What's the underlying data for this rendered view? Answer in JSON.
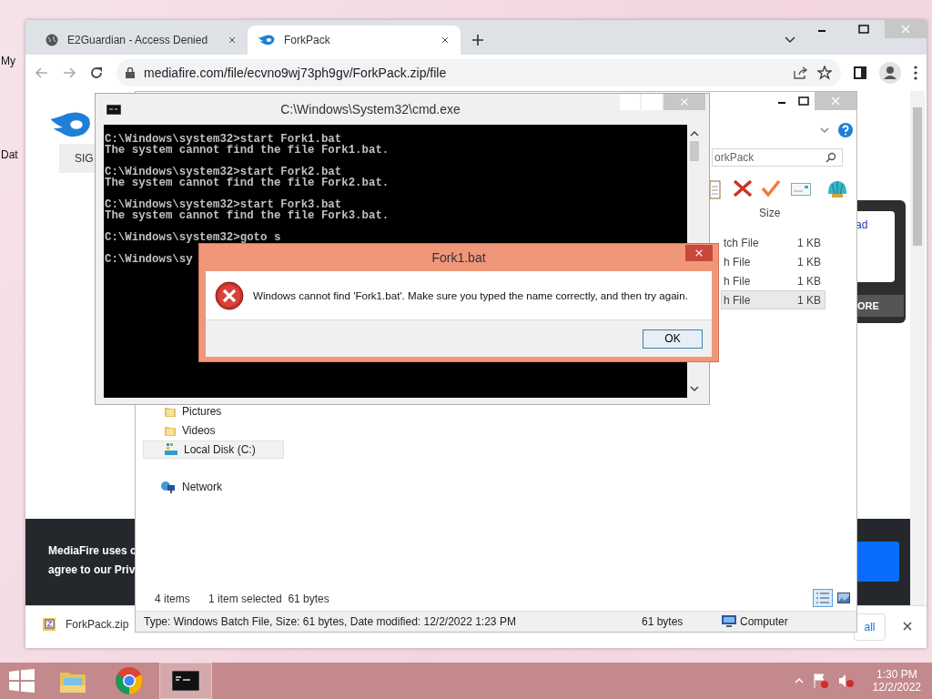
{
  "desktop": {
    "icon_labels": [
      "My",
      "Dat"
    ]
  },
  "browser": {
    "tabs": [
      {
        "title": "E2Guardian - Access Denied",
        "kind": "globe",
        "selected": false
      },
      {
        "title": "ForkPack",
        "kind": "mediafire",
        "selected": true
      }
    ],
    "address": "mediafire.com/file/ecvno9wj73ph9gv/ForkPack.zip/file",
    "page": {
      "sign_in_button": "SIG",
      "side_link": "ad",
      "side_button": "ORE",
      "cookie_lines": [
        "MediaFire uses c",
        "agree to our Priv"
      ]
    },
    "download_bar": {
      "file": "ForkPack.zip",
      "show_all": "all"
    }
  },
  "explorer": {
    "search": "orkPack",
    "columns": [
      "Size"
    ],
    "files": [
      {
        "type": "tch File",
        "size": "1 KB",
        "selected": false
      },
      {
        "type": "h File",
        "size": "1 KB",
        "selected": false
      },
      {
        "type": "h File",
        "size": "1 KB",
        "selected": false
      },
      {
        "type": "h File",
        "size": "1 KB",
        "selected": true
      }
    ],
    "nav": [
      {
        "label": "Pictures",
        "kind": "folder",
        "selected": false
      },
      {
        "label": "Videos",
        "kind": "folder",
        "selected": false
      },
      {
        "label": "Local Disk (C:)",
        "kind": "drive",
        "selected": true
      },
      {
        "label": "Network",
        "kind": "network",
        "selected": false
      }
    ],
    "item_count": "4 items",
    "selection": "1 item selected  61 bytes",
    "details": "Type: Windows Batch File, Size: 61 bytes, Date modified: 12/2/2022 1:23 PM",
    "details_size": "61 bytes",
    "details_location": "Computer"
  },
  "console": {
    "title": "C:\\Windows\\System32\\cmd.exe",
    "blocks": [
      [
        "C:\\Windows\\system32>start Fork1.bat",
        "The system cannot find the file Fork1.bat."
      ],
      [
        "C:\\Windows\\system32>start Fork2.bat",
        "The system cannot find the file Fork2.bat."
      ],
      [
        "C:\\Windows\\system32>start Fork3.bat",
        "The system cannot find the file Fork3.bat."
      ],
      [
        "C:\\Windows\\system32>goto s"
      ],
      [
        "C:\\Windows\\sy"
      ]
    ]
  },
  "dialog": {
    "title": "Fork1.bat",
    "message": "Windows cannot find 'Fork1.bat'. Make sure you typed the name correctly, and then try again.",
    "button": "OK"
  },
  "taskbar": {
    "apps": [
      {
        "kind": "explorer",
        "selected": false
      },
      {
        "kind": "chrome",
        "selected": false
      },
      {
        "kind": "console",
        "selected": true
      }
    ],
    "time": "1:30 PM",
    "date": "12/2/2022"
  }
}
